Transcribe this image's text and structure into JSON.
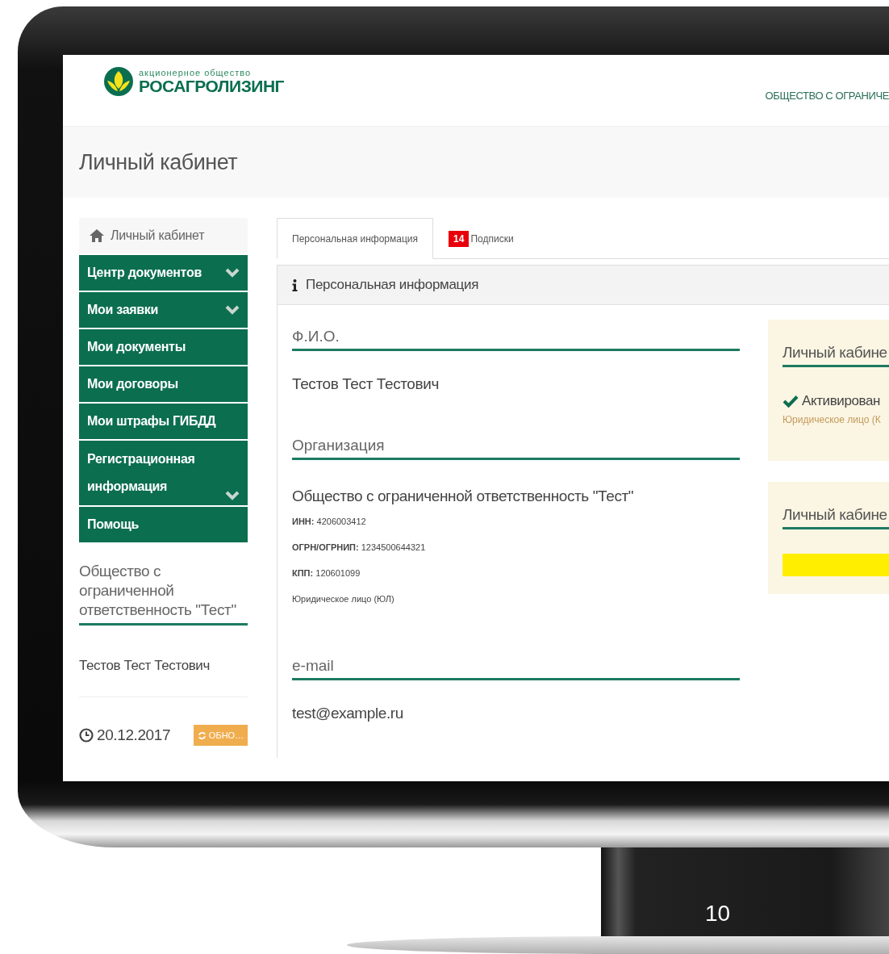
{
  "header": {
    "logo_caption": "акционерное общество",
    "logo_name": "РОСАГРОЛИЗИНГ",
    "organization": "ОБЩЕСТВО С ОГРАНИЧЕ"
  },
  "page_title": "Личный кабинет",
  "sidebar": {
    "home": "Личный кабинет",
    "menu": [
      {
        "label": "Центр документов",
        "expandable": true
      },
      {
        "label": "Мои заявки",
        "expandable": true
      },
      {
        "label": "Мои документы",
        "expandable": false
      },
      {
        "label": "Мои договоры",
        "expandable": false
      },
      {
        "label": "Мои штрафы ГИБДД",
        "expandable": false
      },
      {
        "label": "Регистрационная информация",
        "expandable": true
      },
      {
        "label": "Помощь",
        "expandable": false
      }
    ],
    "company": "Общество с ограниченной ответственность \"Тест\"",
    "user": "Тестов Тест Тестович",
    "date": "20.12.2017",
    "refresh_button": "ОБНО…"
  },
  "tabs": [
    {
      "label": "Персональная информация",
      "selected": true
    },
    {
      "label": "Подписки",
      "badge": "14",
      "selected": false
    }
  ],
  "panel": {
    "title": "Персональная информация",
    "sections": [
      {
        "label": "Ф.И.О.",
        "value": "Тестов Тест Тестович"
      },
      {
        "label": "Организация",
        "value": "Общество с ограниченной ответственность \"Тест\"",
        "details": [
          {
            "key": "ИНН:",
            "value": "4206003412"
          },
          {
            "key": "ОГРН/ОГРНИП:",
            "value": "1234500644321"
          },
          {
            "key": "КПП:",
            "value": "120601099"
          }
        ],
        "note": "Юридическое лицо (ЮЛ)"
      },
      {
        "label": "e-mail",
        "value": "test@example.ru"
      }
    ],
    "cards": [
      {
        "kind": "status",
        "title": "Личный кабине",
        "status": "Активирован",
        "note": "Юридическое лицо (К"
      },
      {
        "kind": "bar",
        "title": "Личный кабине"
      }
    ]
  },
  "slide_number": "10"
}
